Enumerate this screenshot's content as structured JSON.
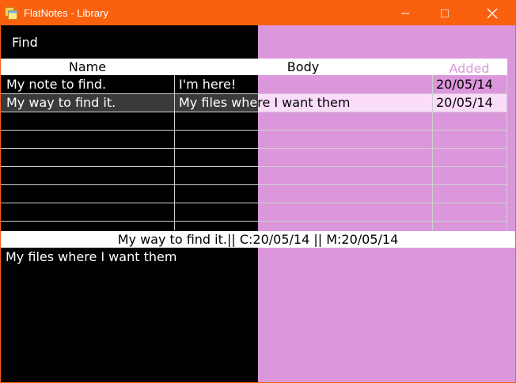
{
  "window": {
    "title": "FlatNotes - Library",
    "accent": "#f9610f",
    "pane_color": "#dc97dc"
  },
  "toolbar": {
    "find_label": "Find"
  },
  "table": {
    "columns": [
      "Name",
      "Body",
      "Added"
    ],
    "rows": [
      {
        "name": "My note to find.",
        "body": "I'm here!",
        "added": "20/05/14"
      },
      {
        "name": "My way to find it.",
        "body": "My files where I want them",
        "added": "20/05/14",
        "selected": true
      }
    ]
  },
  "status": {
    "text": "My way to find it.|| C:20/05/14 || M:20/05/14"
  },
  "preview": {
    "text": "My files where I want them"
  }
}
